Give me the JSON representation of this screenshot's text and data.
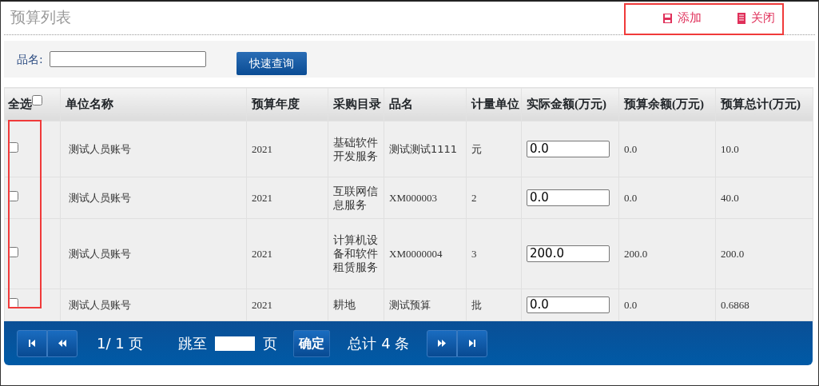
{
  "title": "预算列表",
  "toolbar": [
    {
      "kind": "add",
      "label": "添加"
    },
    {
      "kind": "close",
      "label": "关闭"
    }
  ],
  "search": {
    "label": "品名:",
    "button": "快速查询"
  },
  "table": {
    "select_all": {
      "label": "全选",
      "checked": false
    },
    "columns": [
      "单位名称",
      "预算年度",
      "采购目录",
      "品名",
      "计量单位",
      "实际金额(万元)",
      "预算余额(万元)",
      "预算总计(万元)"
    ],
    "rows": [
      {
        "checked": false,
        "cells": [
          "测试人员账号",
          "2021",
          "基础软件开发服务",
          "测试测试1111",
          "元",
          "0.0",
          "0.0",
          "10.0"
        ]
      },
      {
        "checked": false,
        "cells": [
          "测试人员账号",
          "2021",
          "互联网信息服务",
          "XM000003",
          "2",
          "0.0",
          "0.0",
          "40.0"
        ]
      },
      {
        "checked": false,
        "cells": [
          "测试人员账号",
          "2021",
          "计算机设备和软件租赁服务",
          "XM0000004",
          "3",
          "200.0",
          "200.0",
          "200.0"
        ]
      },
      {
        "checked": false,
        "cells": [
          "测试人员账号",
          "2021",
          "耕地",
          "测试预算",
          "批",
          "0.0",
          "0.0",
          "0.6868"
        ]
      }
    ]
  },
  "pager": {
    "page": "1/ 1 页",
    "jump_label": "跳至",
    "jump_unit": "页",
    "go": "确定",
    "total": "总计 4 条"
  }
}
